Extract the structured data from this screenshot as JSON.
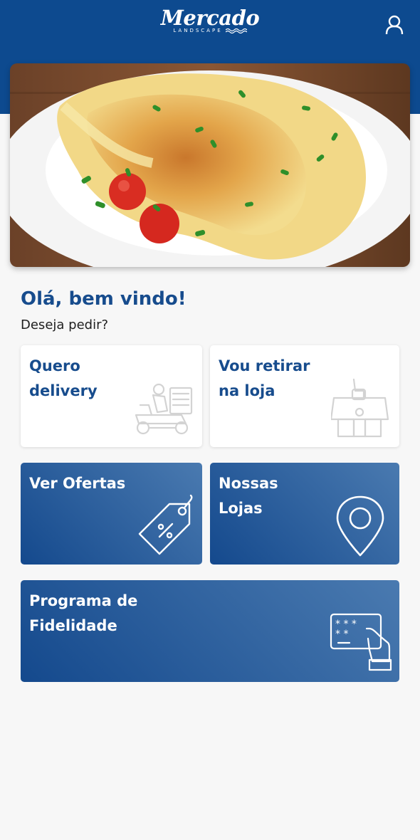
{
  "header": {
    "logo_text": "Mercado",
    "logo_sub": "LANDSCAPE",
    "user_icon": "user-icon",
    "background_color": "#0d4a8f"
  },
  "hero": {
    "image": "omelette-plate-photo"
  },
  "welcome": {
    "title": "Olá, bem vindo!",
    "subtitle": "Deseja pedir?"
  },
  "options": {
    "delivery": {
      "line1": "Quero",
      "line2": "delivery",
      "icon": "delivery-scooter-icon"
    },
    "pickup": {
      "line1": "Vou retirar",
      "line2": "na loja",
      "icon": "store-pickup-icon"
    },
    "offers": {
      "line1": "Ver Ofertas",
      "icon": "discount-tag-icon"
    },
    "stores": {
      "line1": "Nossas",
      "line2": "Lojas",
      "icon": "location-pin-icon"
    },
    "loyalty": {
      "line1": "Programa de",
      "line2": "Fidelidade",
      "icon": "card-payment-icon"
    }
  },
  "colors": {
    "primary": "#174c8d",
    "card_gradient_start": "#14498d",
    "card_gradient_end": "#4a7ab0"
  }
}
